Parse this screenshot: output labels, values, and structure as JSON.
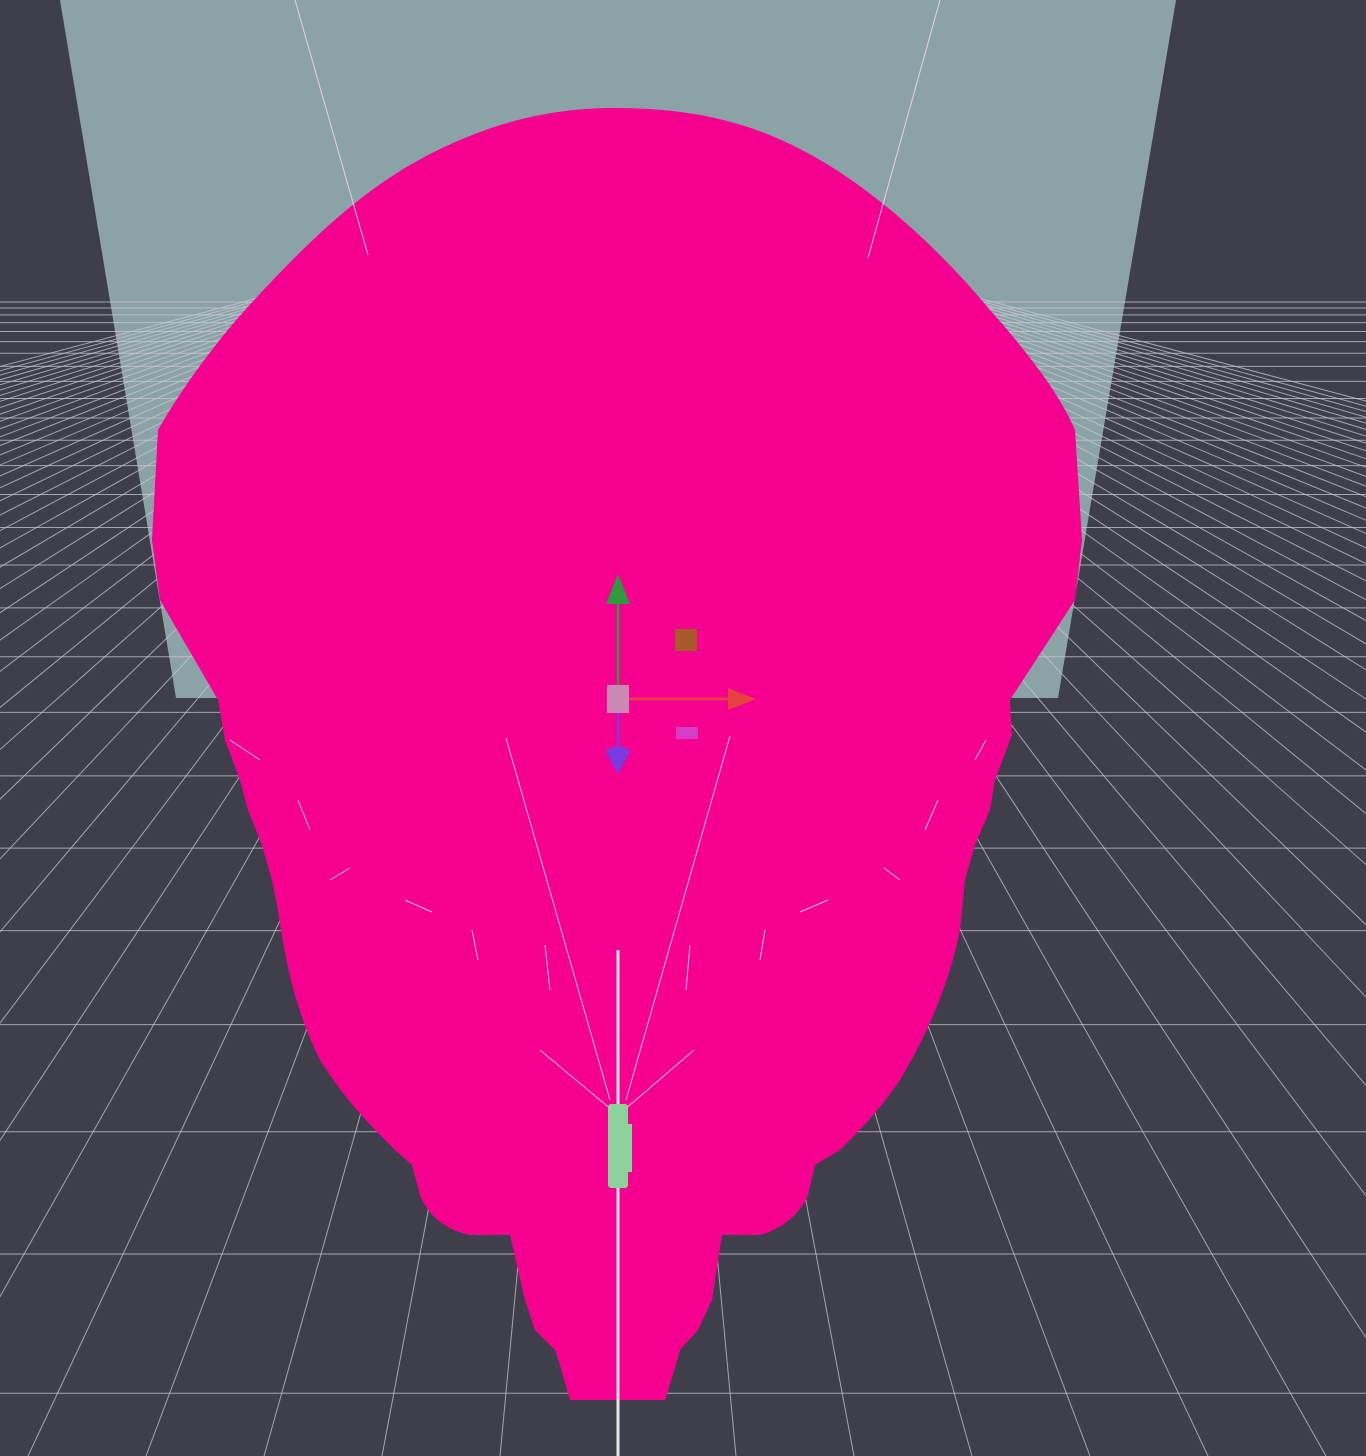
{
  "viewport": {
    "background_color": "#3f3f4b",
    "grid_color": "#c8c8d0",
    "backdrop_color": "#8ba3a7",
    "mesh_color": "#f5008f",
    "light_ray_color": "#f4d2e8"
  },
  "selected_object": {
    "icon": "cone-mesh-icon"
  },
  "gizmo": {
    "x_axis_color": "#e3423f",
    "y_axis_color": "#2e9a3e",
    "z_axis_color": "#7a3ae0",
    "center_handle_color": "#c88ab4",
    "plane_handle_xy_color": "#a85a2a",
    "plane_handle_xz_color": "#d63cc4"
  },
  "light_object": {
    "icon": "spot-light-icon",
    "color": "#8ad49a"
  }
}
